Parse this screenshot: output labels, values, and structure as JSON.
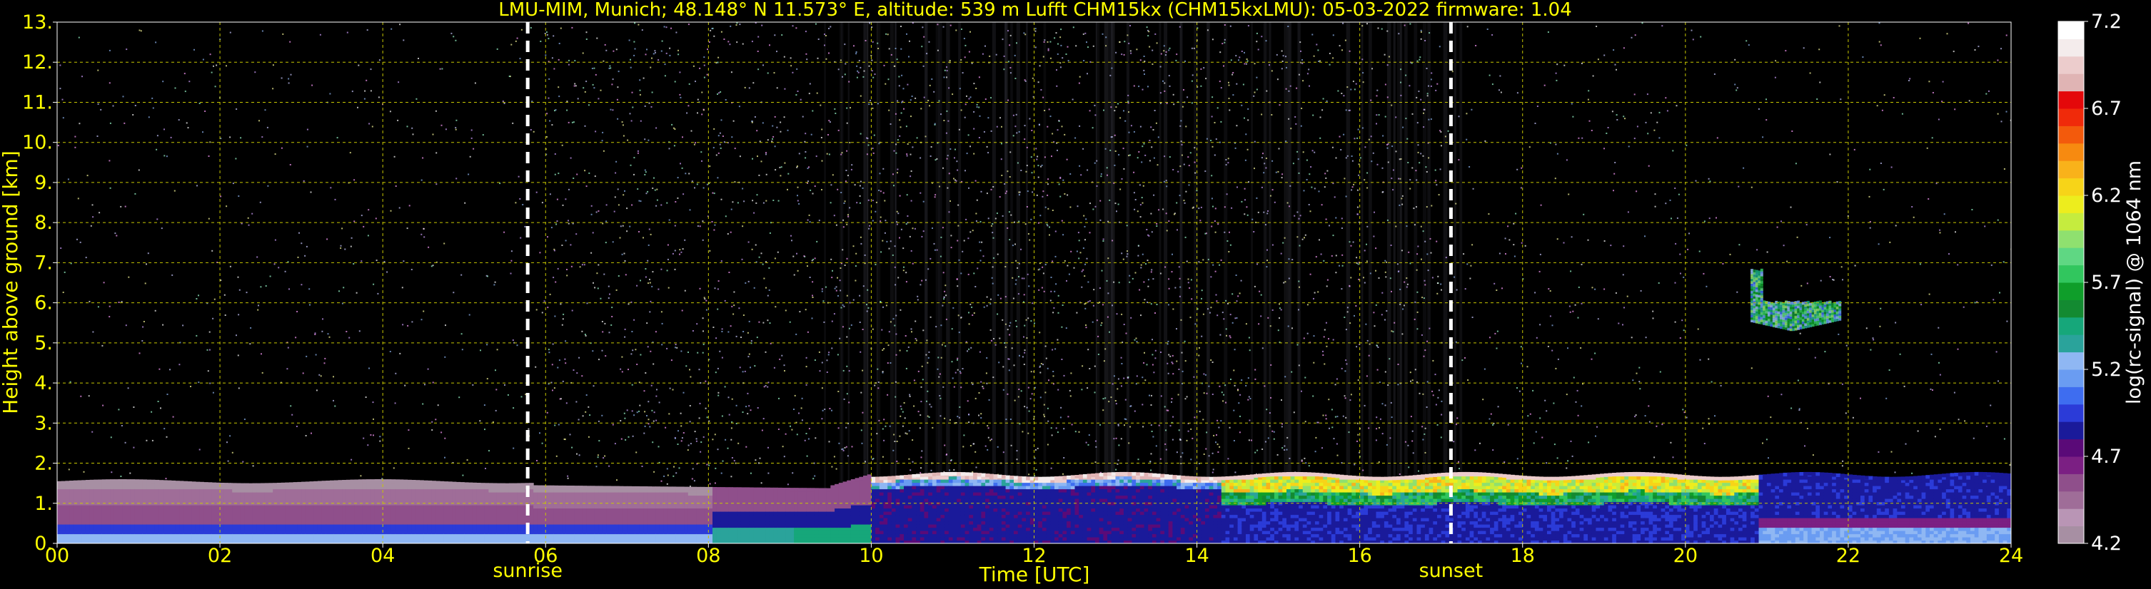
{
  "chart_data": {
    "type": "heatmap",
    "title": "LMU-MIM, Munich; 48.148° N 11.573° E, altitude: 539 m    Lufft CHM15kx (CHM15kxLMU): 05-03-2022    firmware: 1.04",
    "xlabel": "Time [UTC]",
    "ylabel": "Height above ground [km]",
    "xlim": [
      0,
      24
    ],
    "ylim": [
      0,
      13
    ],
    "x_ticks": [
      "00",
      "02",
      "04",
      "06",
      "08",
      "10",
      "12",
      "14",
      "16",
      "18",
      "20",
      "22",
      "24"
    ],
    "y_ticks": [
      "0.",
      "1.",
      "2.",
      "3.",
      "4.",
      "5.",
      "6.",
      "7.",
      "8.",
      "9.",
      "10.",
      "11.",
      "12.",
      "13."
    ],
    "grid": true,
    "colorbar": {
      "label": "log(rc-signal) @ 1064 nm",
      "range": [
        4.2,
        7.2
      ],
      "ticks": [
        "4.2",
        "4.7",
        "5.2",
        "5.7",
        "6.2",
        "6.7",
        "7.2"
      ],
      "colors": [
        "#a78fa3",
        "#b995b5",
        "#9f6d98",
        "#8f4f8b",
        "#7b1f83",
        "#5a0a78",
        "#1a1a9a",
        "#2b3bd8",
        "#3e6df0",
        "#6a9cf2",
        "#8fb7f3",
        "#2aa39b",
        "#16a77a",
        "#138a31",
        "#0f9e2a",
        "#31c65e",
        "#5fd783",
        "#8fe06f",
        "#c5ec3e",
        "#eded1d",
        "#f7d418",
        "#f9b21a",
        "#f78a10",
        "#f35a0c",
        "#f02a0a",
        "#e4080a",
        "#e0b4b4",
        "#eccccc",
        "#f4ecec",
        "#ffffff"
      ]
    },
    "markers": [
      {
        "label": "sunrise",
        "x": 5.78
      },
      {
        "label": "sunset",
        "x": 17.12
      }
    ],
    "features": [
      {
        "name": "boundary layer aerosol",
        "x_range": [
          0,
          24
        ],
        "height_km_range": [
          0,
          1.7
        ],
        "level": [
          4.6,
          6.2
        ]
      },
      {
        "name": "elevated cloud",
        "x_range": [
          20.8,
          21.9
        ],
        "height_km_range": [
          5.3,
          6.8
        ],
        "level": [
          5.0,
          6.0
        ]
      }
    ],
    "colors": {
      "background": "#000000",
      "text": "#ffff00",
      "grid": "#c8c800",
      "marker": "#ffffff"
    }
  }
}
